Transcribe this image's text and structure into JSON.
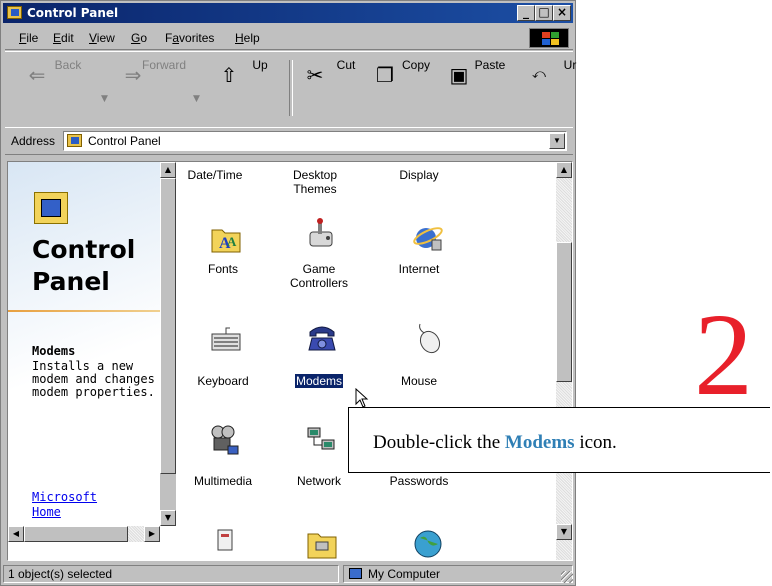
{
  "window": {
    "title": "Control Panel",
    "controls": [
      "_",
      "□",
      "×"
    ]
  },
  "menu": {
    "items": [
      {
        "key": "F",
        "rest": "ile"
      },
      {
        "key": "E",
        "rest": "dit"
      },
      {
        "key": "V",
        "rest": "iew"
      },
      {
        "key": "G",
        "rest": "o"
      },
      {
        "pre": "F",
        "key": "a",
        "rest": "vorites"
      },
      {
        "key": "H",
        "rest": "elp"
      }
    ]
  },
  "toolbar": {
    "back": "Back",
    "forward": "Forward",
    "up": "Up",
    "cut": "Cut",
    "copy": "Copy",
    "paste": "Paste",
    "undo": "Ur"
  },
  "address": {
    "label": "Address",
    "value": "Control Panel"
  },
  "left_pane": {
    "title_line1": "Control",
    "title_line2": "Panel",
    "item_name": "Modems",
    "item_desc": "Installs a new modem and changes modem properties.",
    "link_line1": "Microsoft",
    "link_line2": "Home"
  },
  "icons": {
    "row0": [
      "Date/Time",
      "Desktop\nThemes",
      "Display"
    ],
    "row1": [
      "Fonts",
      "Game\nControllers",
      "Internet"
    ],
    "row2": [
      "Keyboard",
      "Modems",
      "Mouse"
    ],
    "row3": [
      "Multimedia",
      "Network",
      "Passwords"
    ]
  },
  "status": {
    "selection": "1 object(s) selected",
    "zone": "My Computer"
  },
  "callout": {
    "text_before": "Double-click the ",
    "text_emphasis": "Modems",
    "text_after": " icon."
  },
  "step_number": "2",
  "colors": {
    "titlebar": "#0a246a",
    "selection": "#0a246a",
    "callout_emphasis": "#2f7fb5",
    "step_number": "#e8202a"
  }
}
